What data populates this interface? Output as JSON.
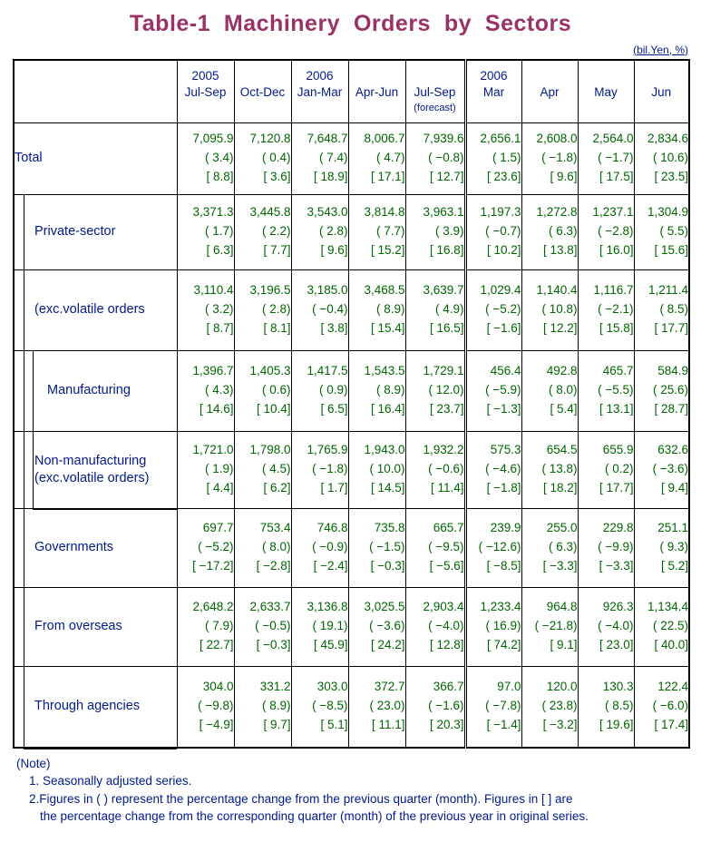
{
  "title": "Table-1  Machinery  Orders  by  Sectors",
  "unit_label": "(bil.Yen, %)",
  "header": {
    "corner": "",
    "columns": [
      {
        "year": "2005",
        "period": "Jul-Sep",
        "sub": ""
      },
      {
        "year": "",
        "period": "Oct-Dec",
        "sub": ""
      },
      {
        "year": "2006",
        "period": "Jan-Mar",
        "sub": ""
      },
      {
        "year": "",
        "period": "Apr-Jun",
        "sub": ""
      },
      {
        "year": "",
        "period": "Jul-Sep",
        "sub": "(forecast)"
      },
      {
        "year": "2006",
        "period": "Mar",
        "sub": ""
      },
      {
        "year": "",
        "period": "Apr",
        "sub": ""
      },
      {
        "year": "",
        "period": "May",
        "sub": ""
      },
      {
        "year": "",
        "period": "Jun",
        "sub": ""
      }
    ]
  },
  "rows": [
    {
      "label": "Total",
      "label2": "",
      "level": 0,
      "values": [
        "7,095.9",
        "7,120.8",
        "7,648.7",
        "8,006.7",
        "7,939.6",
        "2,656.1",
        "2,608.0",
        "2,564.0",
        "2,834.6"
      ],
      "qoq": [
        "( 3.4)",
        "( 0.4)",
        "( 7.4)",
        "( 4.7)",
        "( −0.8)",
        "( 1.5)",
        "( −1.8)",
        "( −1.7)",
        "( 10.6)"
      ],
      "yoy": [
        "[ 8.8]",
        "[ 3.6]",
        "[ 18.9]",
        "[ 17.1]",
        "[ 12.7]",
        "[ 23.6]",
        "[ 9.6]",
        "[ 17.5]",
        "[ 23.5]"
      ]
    },
    {
      "label": "Private-sector",
      "label2": "",
      "level": 1,
      "values": [
        "3,371.3",
        "3,445.8",
        "3,543.0",
        "3,814.8",
        "3,963.1",
        "1,197.3",
        "1,272.8",
        "1,237.1",
        "1,304.9"
      ],
      "qoq": [
        "( 1.7)",
        "( 2.2)",
        "( 2.8)",
        "( 7.7)",
        "( 3.9)",
        "( −0.7)",
        "( 6.3)",
        "( −2.8)",
        "( 5.5)"
      ],
      "yoy": [
        "[ 6.3]",
        "[ 7.7]",
        "[ 9.6]",
        "[ 15.2]",
        "[ 16.8]",
        "[ 10.2]",
        "[ 13.8]",
        "[ 16.0]",
        "[ 15.6]"
      ]
    },
    {
      "label": "(exc.volatile orders",
      "label2": "",
      "level": 1,
      "values": [
        "3,110.4",
        "3,196.5",
        "3,185.0",
        "3,468.5",
        "3,639.7",
        "1,029.4",
        "1,140.4",
        "1,116.7",
        "1,211.4"
      ],
      "qoq": [
        "( 3.2)",
        "( 2.8)",
        "( −0.4)",
        "( 8.9)",
        "( 4.9)",
        "( −5.2)",
        "( 10.8)",
        "( −2.1)",
        "( 8.5)"
      ],
      "yoy": [
        "[ 8.7]",
        "[ 8.1]",
        "[ 3.8]",
        "[ 15.4]",
        "[ 16.5]",
        "[ −1.6]",
        "[ 12.2]",
        "[ 15.8]",
        "[ 17.7]"
      ]
    },
    {
      "label": "Manufacturing",
      "label2": "",
      "level": 2,
      "values": [
        "1,396.7",
        "1,405.3",
        "1,417.5",
        "1,543.5",
        "1,729.1",
        "456.4",
        "492.8",
        "465.7",
        "584.9"
      ],
      "qoq": [
        "( 4.3)",
        "( 0.6)",
        "( 0.9)",
        "( 8.9)",
        "( 12.0)",
        "( −5.9)",
        "( 8.0)",
        "( −5.5)",
        "( 25.6)"
      ],
      "yoy": [
        "[ 14.6]",
        "[ 10.4]",
        "[ 6.5]",
        "[ 16.4]",
        "[ 23.7]",
        "[ −1.3]",
        "[ 5.4]",
        "[ 13.1]",
        "[ 28.7]"
      ]
    },
    {
      "label": "Non-manufacturing",
      "label2": "(exc.volatile orders)",
      "level": 3,
      "values": [
        "1,721.0",
        "1,798.0",
        "1,765.9",
        "1,943.0",
        "1,932.2",
        "575.3",
        "654.5",
        "655.9",
        "632.6"
      ],
      "qoq": [
        "( 1.9)",
        "( 4.5)",
        "( −1.8)",
        "( 10.0)",
        "( −0.6)",
        "( −4.6)",
        "( 13.8)",
        "( 0.2)",
        "( −3.6)"
      ],
      "yoy": [
        "[ 4.4]",
        "[ 6.2]",
        "[ 1.7]",
        "[ 14.5]",
        "[ 11.4]",
        "[ −1.8]",
        "[ 18.2]",
        "[ 17.7]",
        "[ 9.4]"
      ]
    },
    {
      "label": "Governments",
      "label2": "",
      "level": 1,
      "values": [
        "697.7",
        "753.4",
        "746.8",
        "735.8",
        "665.7",
        "239.9",
        "255.0",
        "229.8",
        "251.1"
      ],
      "qoq": [
        "( −5.2)",
        "( 8.0)",
        "( −0.9)",
        "( −1.5)",
        "( −9.5)",
        "( −12.6)",
        "( 6.3)",
        "( −9.9)",
        "( 9.3)"
      ],
      "yoy": [
        "[ −17.2]",
        "[ −2.8]",
        "[ −2.4]",
        "[ −0.3]",
        "[ −5.6]",
        "[ −8.5]",
        "[ −3.3]",
        "[ −3.3]",
        "[ 5.2]"
      ]
    },
    {
      "label": "From overseas",
      "label2": "",
      "level": 1,
      "values": [
        "2,648.2",
        "2,633.7",
        "3,136.8",
        "3,025.5",
        "2,903.4",
        "1,233.4",
        "964.8",
        "926.3",
        "1,134.4"
      ],
      "qoq": [
        "( 7.9)",
        "( −0.5)",
        "( 19.1)",
        "( −3.6)",
        "( −4.0)",
        "( 16.9)",
        "( −21.8)",
        "( −4.0)",
        "( 22.5)"
      ],
      "yoy": [
        "[ 22.7]",
        "[ −0.3]",
        "[ 45.9]",
        "[ 24.2]",
        "[ 12.8]",
        "[ 74.2]",
        "[ 9.1]",
        "[ 23.0]",
        "[ 40.0]"
      ]
    },
    {
      "label": "Through agencies",
      "label2": "",
      "level": 1,
      "values": [
        "304.0",
        "331.2",
        "303.0",
        "372.7",
        "366.7",
        "97.0",
        "120.0",
        "130.3",
        "122.4"
      ],
      "qoq": [
        "( −9.8)",
        "( 8.9)",
        "( −8.5)",
        "( 23.0)",
        "( −1.6)",
        "( −7.8)",
        "( 23.8)",
        "( 8.5)",
        "( −6.0)"
      ],
      "yoy": [
        "[ −4.9]",
        "[ 9.7]",
        "[ 5.1]",
        "[ 11.1]",
        "[ 20.3]",
        "[ −1.4]",
        "[ −3.2]",
        "[ 19.6]",
        "[ 17.4]"
      ]
    }
  ],
  "notes": {
    "head": "(Note)",
    "item1": "1. Seasonally adjusted series.",
    "item2": "2.Figures in ( ) represent the percentage change from the previous quarter (month). Figures in [ ] are",
    "item2_cont": "the percentage change from the corresponding quarter (month) of the previous year in original series."
  },
  "colors": {
    "title": "#993366",
    "label": "#001a8c",
    "data": "#006600",
    "border": "#000000"
  }
}
